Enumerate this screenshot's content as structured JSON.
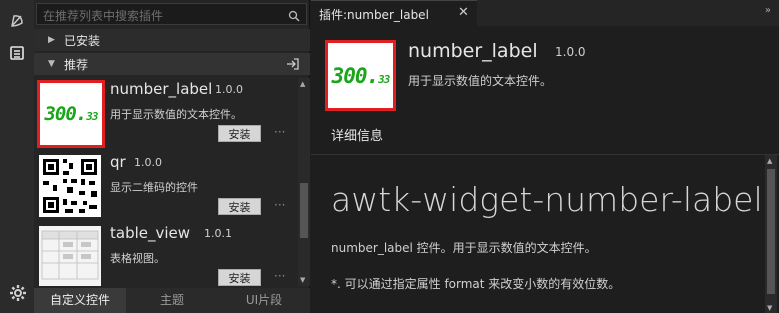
{
  "activity_bar": {
    "icons": [
      "plugin-icon",
      "window-icon",
      "gear-icon"
    ]
  },
  "sidebar": {
    "search": {
      "placeholder": "在推荐列表中搜索插件"
    },
    "section_installed": "已安装",
    "section_recommended": "推荐",
    "plugins": [
      {
        "name": "number_label",
        "version": "1.0.0",
        "desc": "用于显示数值的文本控件。",
        "install": "安装",
        "more": "···",
        "thumb_main": "300.",
        "thumb_small": "33"
      },
      {
        "name": "qr",
        "version": "1.0.0",
        "desc": "显示二维码的控件",
        "install": "安装",
        "more": "···"
      },
      {
        "name": "table_view",
        "version": "1.0.1",
        "desc": "表格视图。",
        "install": "安装",
        "more": "···"
      }
    ],
    "bottom_tabs": [
      "自定义控件",
      "主题",
      "UI片段"
    ]
  },
  "editor": {
    "tab_title": "插件:number_label",
    "tab_close": "✕",
    "header": {
      "name": "number_label",
      "version": "1.0.0",
      "desc": "用于显示数值的文本控件。",
      "detail_tab": "详细信息"
    },
    "doc": {
      "title": "awtk-widget-number-label",
      "p1": "number_label 控件。用于显示数值的文本控件。",
      "p2": "*. 可以通过指定属性 format 来改变小数的有效位数。"
    }
  },
  "colors": {
    "highlight": "#e02020",
    "number_green": "#1aa51a"
  }
}
